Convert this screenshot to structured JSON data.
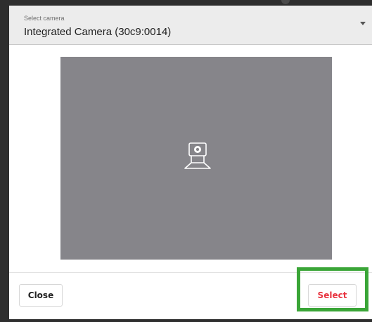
{
  "dialog": {
    "camera_select": {
      "label": "Select camera",
      "value": "Integrated Camera (30c9:0014)"
    },
    "preview": {
      "icon": "webcam-placeholder-icon",
      "background_color": "#86858a"
    },
    "buttons": {
      "close_label": "Close",
      "select_label": "Select",
      "select_color": "#e8333f"
    },
    "highlight_color": "#3aa537"
  }
}
